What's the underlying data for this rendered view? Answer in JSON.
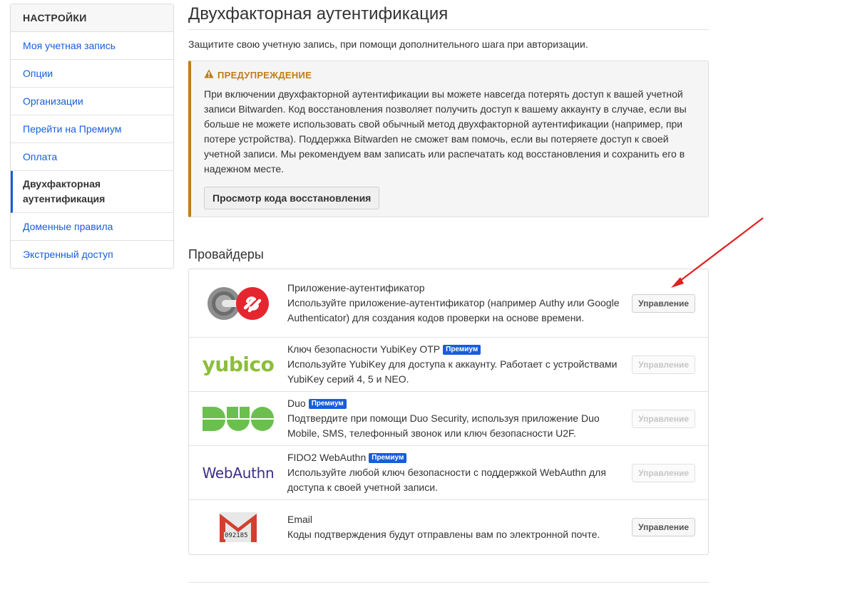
{
  "sidebar": {
    "header": "НАСТРОЙКИ",
    "items": [
      {
        "label": "Моя учетная запись"
      },
      {
        "label": "Опции"
      },
      {
        "label": "Организации"
      },
      {
        "label": "Перейти на Премиум"
      },
      {
        "label": "Оплата"
      },
      {
        "label": "Двухфакторная аутентификация"
      },
      {
        "label": "Доменные правила"
      },
      {
        "label": "Экстренный доступ"
      }
    ]
  },
  "main": {
    "title": "Двухфакторная аутентификация",
    "intro": "Защитите свою учетную запись, при помощи дополнительного шага при авторизации.",
    "warning": {
      "title": "ПРЕДУПРЕЖДЕНИЕ",
      "body": "При включении двухфакторной аутентификации вы можете навсегда потерять доступ к вашей учетной записи Bitwarden. Код восстановления позволяет получить доступ к вашему аккаунту в случае, если вы больше не можете использовать свой обычный метод двухфакторной аутентификации (например, при потере устройства). Поддержка Bitwarden не сможет вам помочь, если вы потеряете доступ к своей учетной записи. Мы рекомендуем вам записать или распечатать код восстановления и сохранить его в надежном месте.",
      "button": "Просмотр кода восстановления"
    },
    "providers_title": "Провайдеры",
    "providers": [
      {
        "name": "Приложение-аутентификатор",
        "description": "Используйте приложение-аутентификатор (например Authy или Google Authenticator) для создания кодов проверки на основе времени.",
        "button": "Управление"
      },
      {
        "name": "Ключ безопасности YubiKey OTP",
        "badge": "Премиум",
        "description": "Используйте YubiKey для доступа к аккаунту. Работает с устройствами YubiKey серий 4, 5 и NEO.",
        "button": "Управление",
        "logo_text": "yubico"
      },
      {
        "name": "Duo",
        "badge": "Премиум",
        "description": "Подтвердите при помощи Duo Security, используя приложение Duo Mobile, SMS, телефонный звонок или ключ безопасности U2F.",
        "button": "Управление"
      },
      {
        "name": "FIDO2 WebAuthn",
        "badge": "Премиум",
        "description": "Используйте любой ключ безопасности с поддержкой WebAuthn для доступа к своей учетной записи.",
        "button": "Управление",
        "logo_text": "WebAuthn"
      },
      {
        "name": "Email",
        "description": "Коды подтверждения будут отправлены вам по электронной почте.",
        "button": "Управление",
        "logo_text": "092185"
      }
    ]
  },
  "colors": {
    "link": "#175ddc",
    "warning": "#bf7e16",
    "badge": "#175ddc",
    "arrow": "#e02020"
  }
}
